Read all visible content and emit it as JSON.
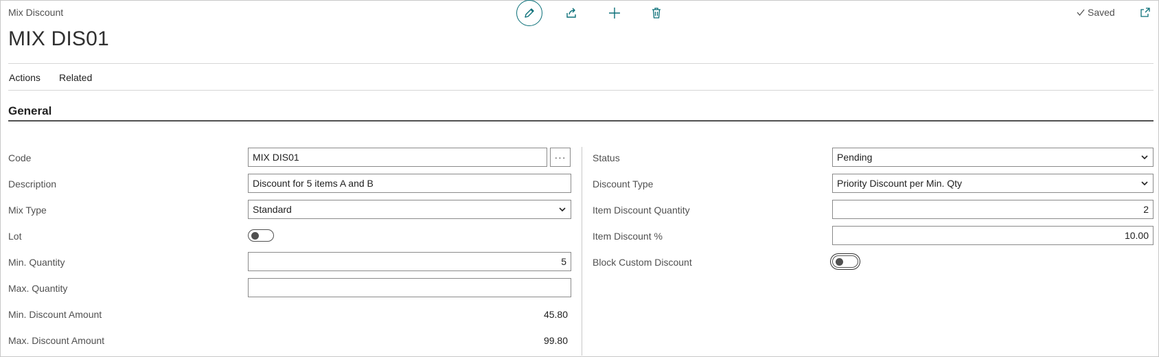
{
  "header": {
    "caption": "Mix Discount",
    "record_title": "MIX DIS01",
    "saved_label": "Saved",
    "icons": [
      "edit-pencil-icon",
      "share-icon",
      "plus-icon",
      "trash-icon",
      "checkmark-icon",
      "popout-icon"
    ]
  },
  "menu": {
    "actions": "Actions",
    "related": "Related"
  },
  "section": {
    "title": "General"
  },
  "left_fields": {
    "code": {
      "label": "Code",
      "value": "MIX DIS01",
      "lookup": "···"
    },
    "description": {
      "label": "Description",
      "value": "Discount for 5 items A and B"
    },
    "mix_type": {
      "label": "Mix Type",
      "value": "Standard"
    },
    "lot": {
      "label": "Lot",
      "on": false
    },
    "min_quantity": {
      "label": "Min. Quantity",
      "value": "5"
    },
    "max_quantity": {
      "label": "Max. Quantity",
      "value": ""
    },
    "min_discount_amount": {
      "label": "Min. Discount Amount",
      "value": "45.80"
    },
    "max_discount_amount": {
      "label": "Max. Discount Amount",
      "value": "99.80"
    }
  },
  "right_fields": {
    "status": {
      "label": "Status",
      "value": "Pending"
    },
    "discount_type": {
      "label": "Discount Type",
      "value": "Priority Discount per Min. Qty"
    },
    "item_discount_quantity": {
      "label": "Item Discount Quantity",
      "value": "2"
    },
    "item_discount_pct": {
      "label": "Item Discount %",
      "value": "10.00"
    },
    "block_custom_discount": {
      "label": "Block Custom Discount",
      "on": false
    }
  },
  "colors": {
    "accent": "#0a6f78",
    "text": "#212121",
    "muted": "#505050",
    "border": "#8a8a8a"
  }
}
